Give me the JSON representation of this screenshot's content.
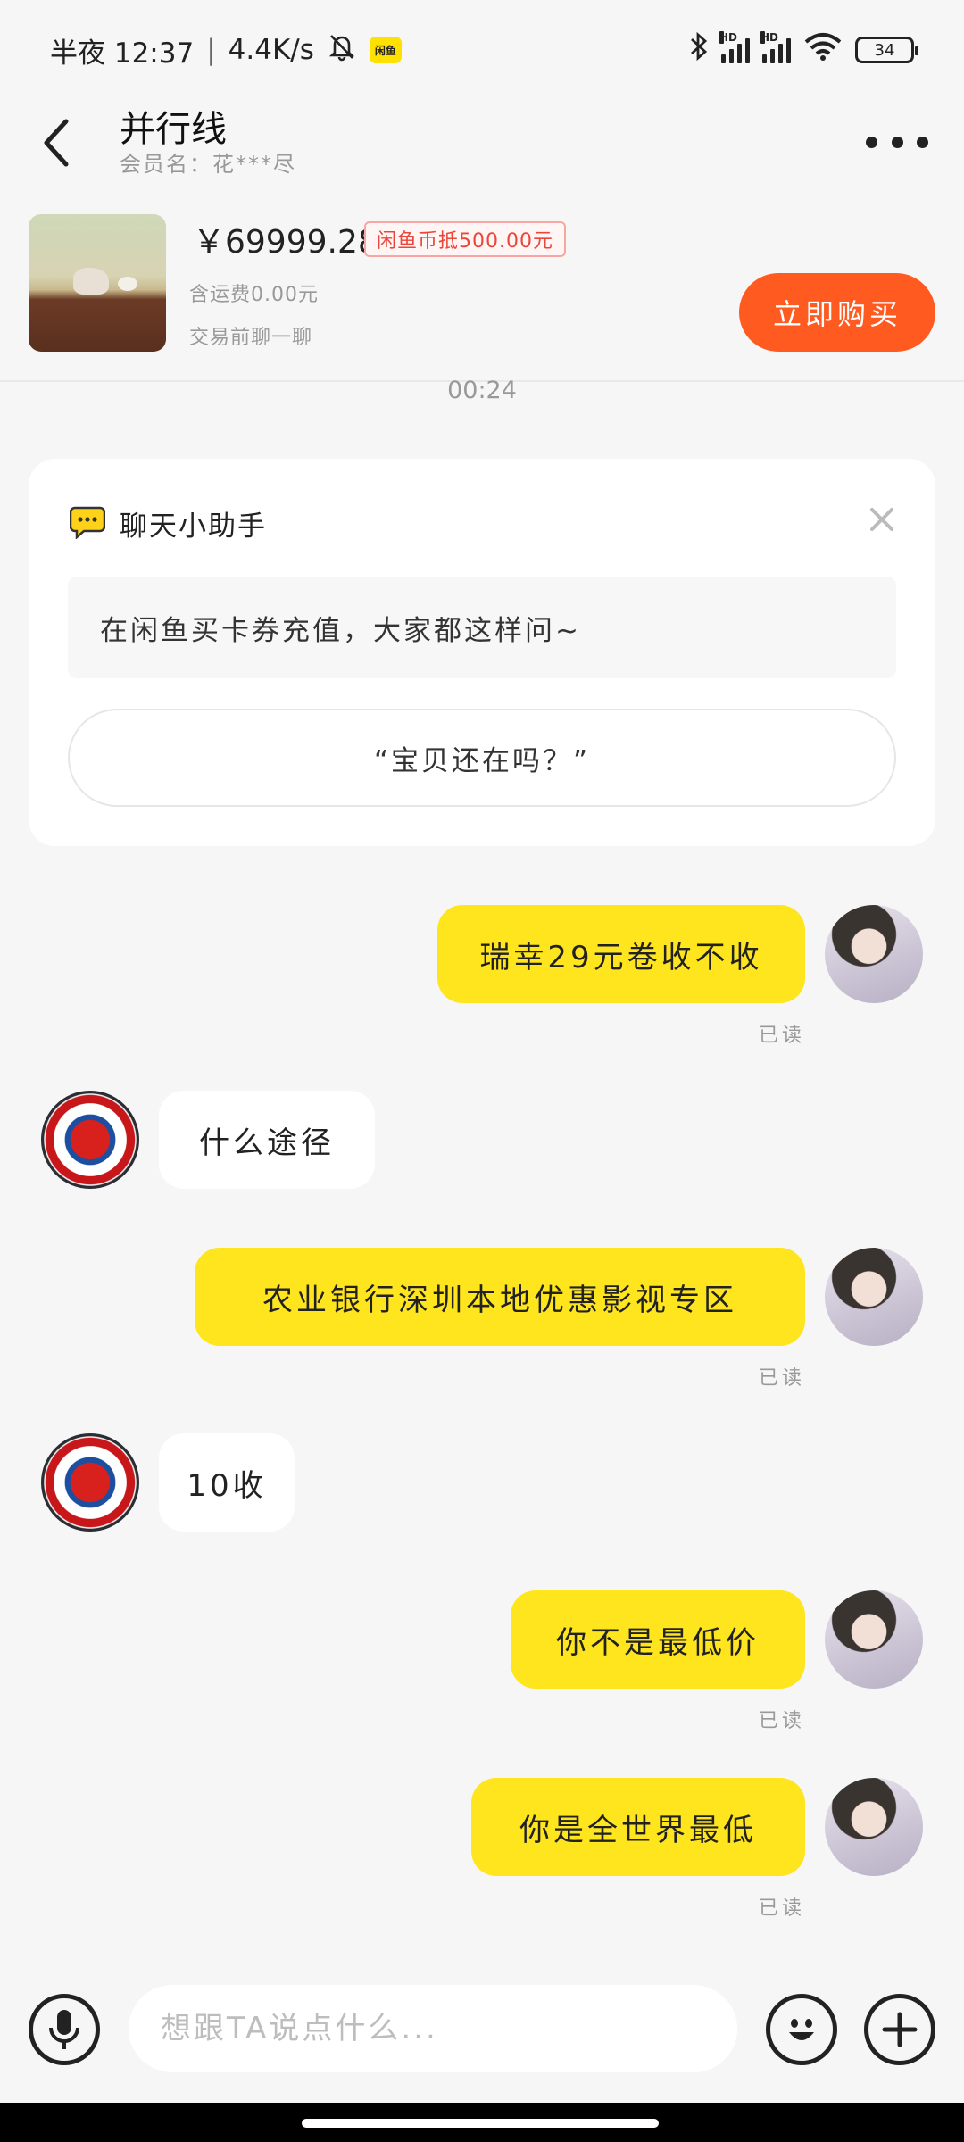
{
  "status_bar": {
    "time": "半夜 12:37",
    "speed": "4.4K/s",
    "app_badge": "闲鱼",
    "battery": "34"
  },
  "header": {
    "title": "并行线",
    "subtitle": "会员名：花***尽"
  },
  "product": {
    "price": "￥69999.28",
    "coin_badge": "闲鱼币抵500.00元",
    "shipping": "含运费0.00元",
    "pre_chat": "交易前聊一聊",
    "buy_label": "立即购买"
  },
  "timestamp": "00:24",
  "assistant": {
    "title": "聊天小助手",
    "hint": "在闲鱼买卡券充值，大家都这样问~",
    "suggestion": "“宝贝还在吗？”"
  },
  "messages": [
    {
      "side": "mine",
      "text": "瑞幸29元卷收不收",
      "read": "已读"
    },
    {
      "side": "theirs",
      "text": "什么途径"
    },
    {
      "side": "mine",
      "text": "农业银行深圳本地优惠影视专区",
      "read": "已读"
    },
    {
      "side": "theirs",
      "text": "10收"
    },
    {
      "side": "mine",
      "text": "你不是最低价",
      "read": "已读"
    },
    {
      "side": "mine",
      "text": "你是全世界最低",
      "read": "已读"
    }
  ],
  "input": {
    "placeholder": "想跟TA说点什么..."
  },
  "colors": {
    "mine_bubble": "#ffe51d",
    "buy_button": "#ff5a1f",
    "coin_badge": "#e9473a"
  }
}
